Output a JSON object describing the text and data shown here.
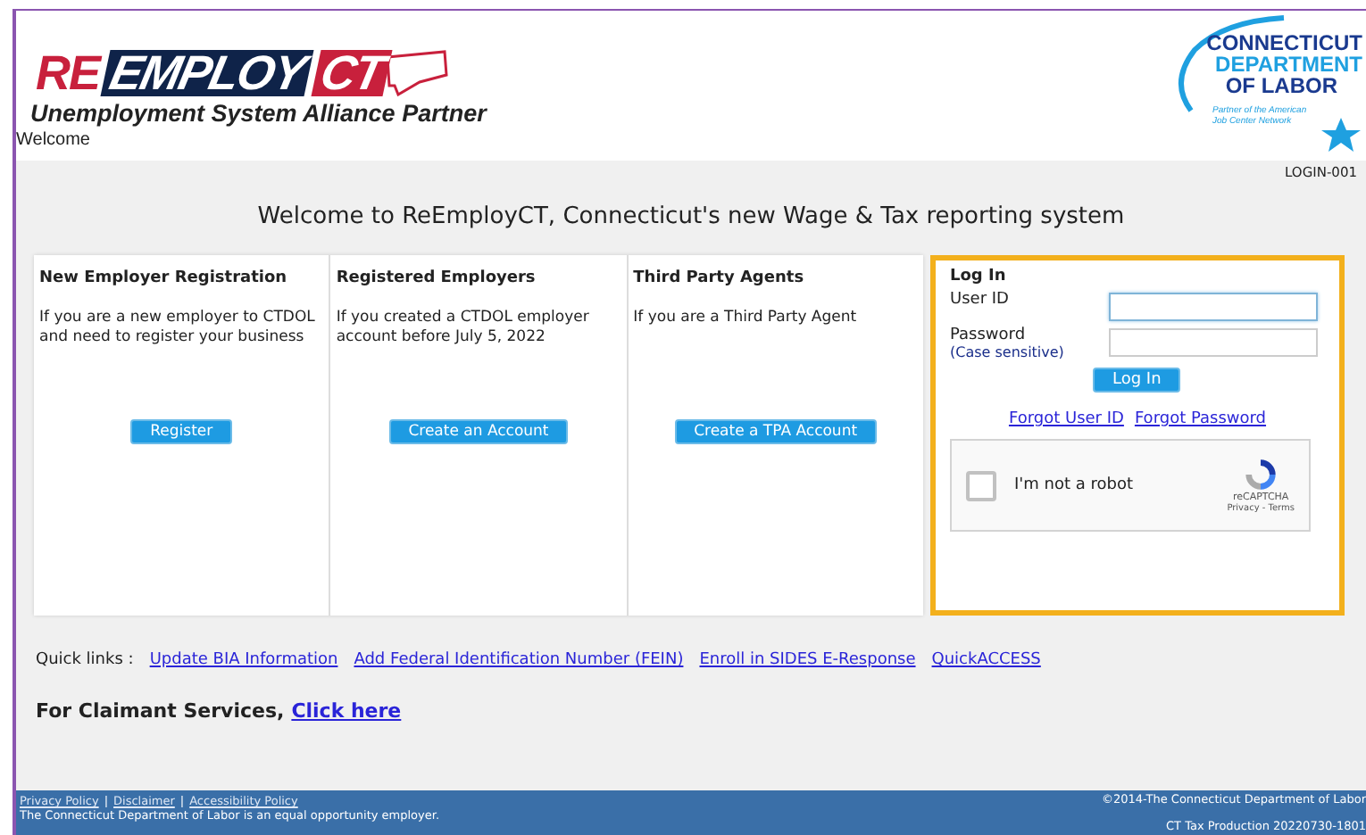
{
  "header": {
    "logo": {
      "parts": [
        "RE",
        "EMPLOY",
        "CT"
      ],
      "tagline": "Unemployment System Alliance Partner"
    },
    "partner_logo": {
      "lines": [
        "CONNECTICUT",
        "DEPARTMENT",
        "OF LABOR"
      ],
      "note": "Partner of the American Job Center Network"
    },
    "welcome": "Welcome"
  },
  "page_id": "LOGIN-001",
  "heading": "Welcome to ReEmployCT, Connecticut's new Wage & Tax reporting system",
  "cards": [
    {
      "title": "New Employer Registration",
      "text": "If you are a new employer to CTDOL and need to register your business",
      "button": "Register"
    },
    {
      "title": "Registered Employers",
      "text": "If you created a CTDOL employer account before July 5, 2022",
      "button": "Create an Account"
    },
    {
      "title": "Third Party Agents",
      "text": "If you are a Third Party Agent",
      "button": "Create a TPA Account"
    }
  ],
  "login": {
    "title": "Log In",
    "fields": [
      {
        "label": "User ID",
        "focused": true
      },
      {
        "label": "Password",
        "hint": "(Case sensitive)",
        "focused": false
      }
    ],
    "button": "Log In",
    "links": [
      "Forgot User ID",
      "Forgot Password"
    ],
    "captcha": {
      "label": "I'm not a robot",
      "checked": false,
      "brand": "reCAPTCHA",
      "terms": "Privacy - Terms"
    }
  },
  "quick_links": {
    "label": "Quick links :",
    "links": [
      "Update BIA Information",
      "Add Federal Identification Number (FEIN)",
      "Enroll in SIDES E-Response",
      "QuickACCESS"
    ]
  },
  "claimant": {
    "text": "For Claimant Services,",
    "link": "Click here"
  },
  "footer": {
    "separator": "|",
    "links": [
      "Privacy Policy",
      "Disclaimer",
      "Accessibility Policy"
    ],
    "notice": "The Connecticut Department of Labor is an equal opportunity employer.",
    "copyright": "©2014-The Connecticut Department of Labor",
    "build": "CT Tax Production 20220730-1801"
  }
}
